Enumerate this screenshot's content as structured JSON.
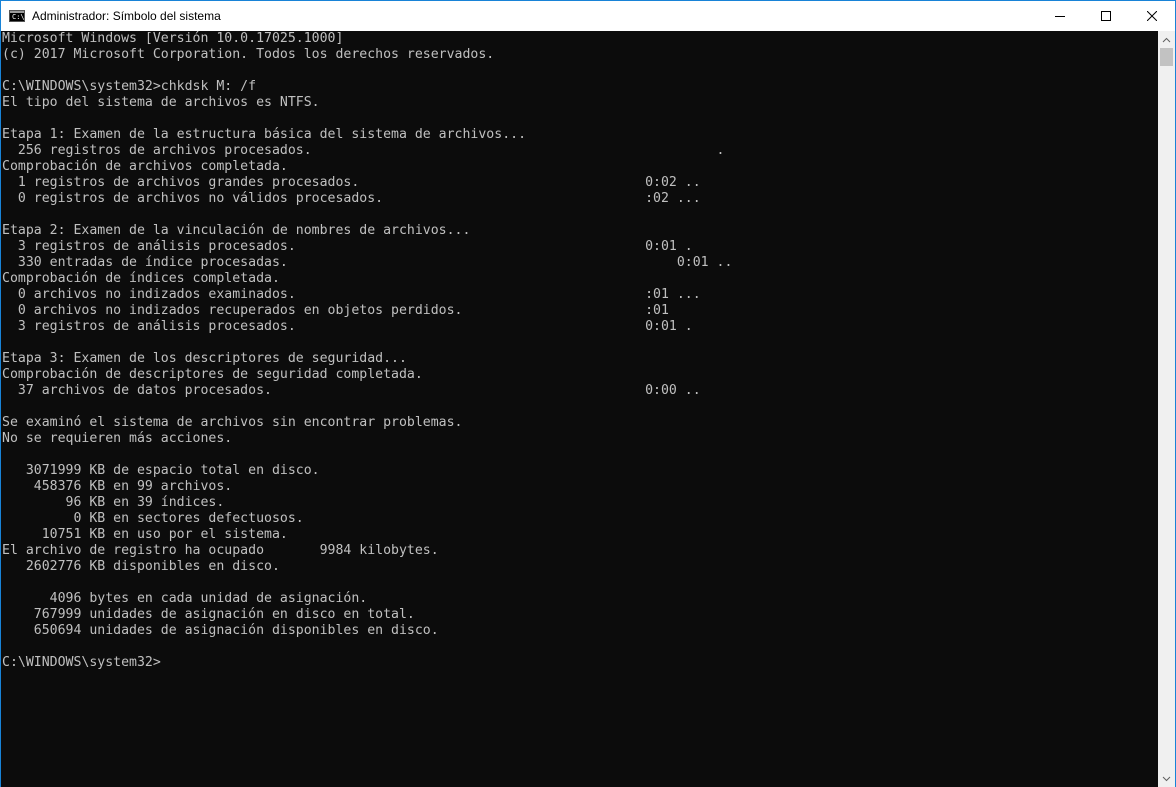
{
  "window": {
    "title": "Administrador: Símbolo del sistema",
    "icon": "cmd-icon",
    "icon_text": "C:\\."
  },
  "controls": {
    "minimize_icon": "minimize-icon",
    "maximize_icon": "maximize-icon",
    "close_icon": "close-icon"
  },
  "console": {
    "lines": [
      "Microsoft Windows [Versión 10.0.17025.1000]",
      "(c) 2017 Microsoft Corporation. Todos los derechos reservados.",
      "",
      "C:\\WINDOWS\\system32>chkdsk M: /f",
      "El tipo del sistema de archivos es NTFS.",
      "",
      "Etapa 1: Examen de la estructura básica del sistema de archivos...",
      "  256 registros de archivos procesados.                                                   .",
      "Comprobación de archivos completada.",
      "  1 registros de archivos grandes procesados.                                    0:02 ..",
      "  0 registros de archivos no válidos procesados.                                 :02 ...",
      "",
      "Etapa 2: Examen de la vinculación de nombres de archivos...",
      "  3 registros de análisis procesados.                                            0:01 .",
      "  330 entradas de índice procesadas.                                                 0:01 ..",
      "Comprobación de índices completada.",
      "  0 archivos no indizados examinados.                                            :01 ...",
      "  0 archivos no indizados recuperados en objetos perdidos.                       :01",
      "  3 registros de análisis procesados.                                            0:01 .",
      "",
      "Etapa 3: Examen de los descriptores de seguridad...",
      "Comprobación de descriptores de seguridad completada.",
      "  37 archivos de datos procesados.                                               0:00 ..",
      "",
      "Se examinó el sistema de archivos sin encontrar problemas.",
      "No se requieren más acciones.",
      "",
      "   3071999 KB de espacio total en disco.",
      "    458376 KB en 99 archivos.",
      "        96 KB en 39 índices.",
      "         0 KB en sectores defectuosos.",
      "     10751 KB en uso por el sistema.",
      "El archivo de registro ha ocupado       9984 kilobytes.",
      "   2602776 KB disponibles en disco.",
      "",
      "      4096 bytes en cada unidad de asignación.",
      "    767999 unidades de asignación en disco en total.",
      "    650694 unidades de asignación disponibles en disco.",
      "",
      "C:\\WINDOWS\\system32>"
    ]
  },
  "scrollbar": {
    "up_icon": "scroll-up-arrow-icon",
    "down_icon": "scroll-down-arrow-icon"
  },
  "colors": {
    "console_bg": "#0c0c0c",
    "console_text": "#c0c0c0",
    "titlebar_bg": "#ffffff",
    "window_border": "#1883d7"
  }
}
